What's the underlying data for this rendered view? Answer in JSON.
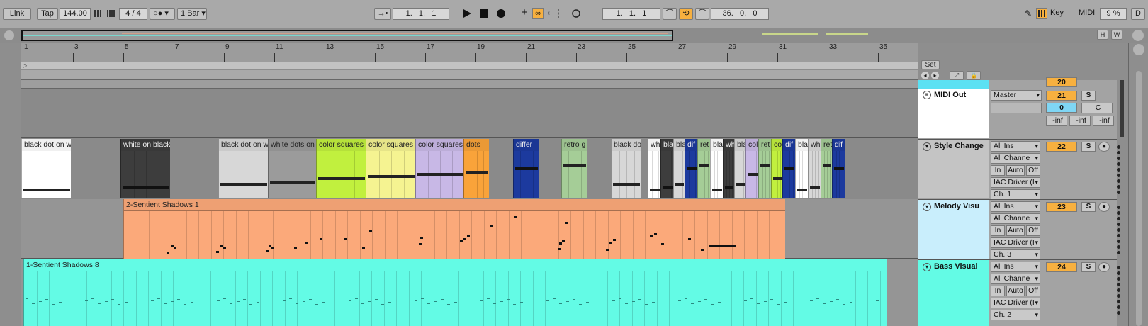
{
  "transport": {
    "link": "Link",
    "tap": "Tap",
    "tempo": "144.00",
    "signature": "4 / 4",
    "quantize": "1 Bar",
    "position": "1.   1.   1",
    "loop_start": "1.   1.   1",
    "loop_length": "36.   0.   0",
    "key": "Key",
    "midi": "MIDI",
    "cpu": "9 %",
    "d": "D"
  },
  "overview": {
    "h": "H",
    "w": "W"
  },
  "ruler": {
    "bars": [
      "1",
      "3",
      "5",
      "7",
      "9",
      "11",
      "13",
      "15",
      "17",
      "19",
      "21",
      "23",
      "25",
      "27",
      "29",
      "31",
      "33",
      "35"
    ],
    "set": "Set"
  },
  "clips_style": [
    {
      "name": "black dot on w",
      "color": "#ffffff",
      "level": 0.88
    },
    {
      "name": "white on black",
      "color": "#3d3d3d",
      "level": 0.84
    },
    {
      "name": "black dot on w",
      "color": "#d7d7d7",
      "level": 0.75
    },
    {
      "name": "white dots on",
      "color": "#9b9b9b",
      "level": 0.7
    },
    {
      "name": "color squares",
      "color": "#c1f03e",
      "level": 0.62
    },
    {
      "name": "color squares",
      "color": "#f5f391",
      "level": 0.57
    },
    {
      "name": "color squares",
      "color": "#c8b8e6",
      "level": 0.52
    },
    {
      "name": "dots",
      "color": "#f9a33a",
      "level": 0.46
    },
    {
      "name": "differ",
      "color": "#1c3a9e",
      "level": 0.38
    },
    {
      "name": "retro g",
      "color": "#a5cd97",
      "level": 0.3
    },
    {
      "name": "black do",
      "color": "#d7d7d7",
      "level": 0.75
    },
    {
      "name": "wh",
      "color": "#ffffff",
      "level": 0.88
    },
    {
      "name": "bla",
      "color": "#3d3d3d",
      "level": 0.84
    },
    {
      "name": "bla",
      "color": "#d7d7d7",
      "level": 0.75
    },
    {
      "name": "dif",
      "color": "#1c3a9e",
      "level": 0.38
    },
    {
      "name": "ret",
      "color": "#a5cd97",
      "level": 0.3
    },
    {
      "name": "bla",
      "color": "#ffffff",
      "level": 0.88
    },
    {
      "name": "wh",
      "color": "#3d3d3d",
      "level": 0.84
    },
    {
      "name": "bla",
      "color": "#d7d7d7",
      "level": 0.75
    },
    {
      "name": "col",
      "color": "#c8b8e6",
      "level": 0.52
    },
    {
      "name": "ret",
      "color": "#a5cd97",
      "level": 0.3
    },
    {
      "name": "col",
      "color": "#c1f03e",
      "level": 0.62
    },
    {
      "name": "dif",
      "color": "#1c3a9e",
      "level": 0.38
    },
    {
      "name": "bla",
      "color": "#ffffff",
      "level": 0.88
    },
    {
      "name": "wh",
      "color": "#d7d7d7",
      "level": 0.84
    },
    {
      "name": "ret",
      "color": "#a5cd97",
      "level": 0.3
    },
    {
      "name": "dif",
      "color": "#1c3a9e",
      "level": 0.38
    }
  ],
  "clip_melody": {
    "name": "2-Sentient Shadows 1",
    "color": "#fba97a"
  },
  "clip_bass": {
    "name": "1-Sentient Shadows 8",
    "color": "#63fbe5"
  },
  "tracks": {
    "top_partial": {
      "number": "20"
    },
    "midi_out": {
      "name": "MIDI Out",
      "output": "Master",
      "number": "21",
      "solo": "S",
      "volume": "0",
      "pan": "C",
      "inf1": "-inf",
      "inf2": "-inf",
      "inf3": "-inf"
    },
    "style_change": {
      "name": "Style Change",
      "input": "All Ins",
      "channel": "All Channe",
      "in": "In",
      "auto": "Auto",
      "off": "Off",
      "driver": "IAC Driver (I",
      "out_ch": "Ch. 1",
      "number": "22",
      "solo": "S"
    },
    "melody_visu": {
      "name": "Melody Visu",
      "input": "All Ins",
      "channel": "All Channe",
      "in": "In",
      "auto": "Auto",
      "off": "Off",
      "driver": "IAC Driver (I",
      "out_ch": "Ch. 3",
      "number": "23",
      "solo": "S"
    },
    "bass_visual": {
      "name": "Bass Visual",
      "input": "All Ins",
      "channel": "All Channe",
      "in": "In",
      "auto": "Auto",
      "off": "Off",
      "driver": "IAC Driver (I",
      "out_ch": "Ch. 2",
      "number": "24",
      "solo": "S"
    }
  },
  "colors": {
    "melody": "#fba97a",
    "bass": "#63fbe5",
    "accent": "#f7b03f",
    "track_header_cyan": "#c9eefc"
  }
}
